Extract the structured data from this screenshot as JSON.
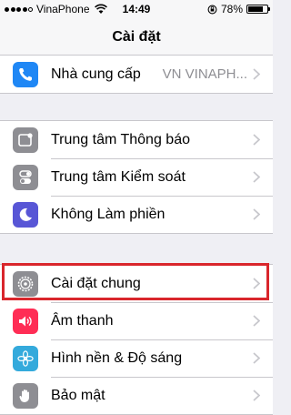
{
  "status_bar": {
    "signal_bars_filled": 4,
    "signal_bars_total": 5,
    "carrier": "VinaPhone",
    "time": "14:49",
    "battery_percent": "78%",
    "battery_level": 0.78,
    "icons": [
      "signal-dots",
      "wifi-icon",
      "rotation-lock-icon",
      "battery-icon"
    ]
  },
  "nav": {
    "title": "Cài đặt"
  },
  "groups": [
    {
      "items": [
        {
          "label": "Nhà cung cấp",
          "value": "VN VINAPH...",
          "icon": "phone-icon",
          "icon_color": "#1f87f5"
        }
      ]
    },
    {
      "items": [
        {
          "label": "Trung tâm Thông báo",
          "icon": "notification-center-icon",
          "icon_color": "#8e8e93"
        },
        {
          "label": "Trung tâm Kiểm soát",
          "icon": "control-center-icon",
          "icon_color": "#8e8e93"
        },
        {
          "label": "Không Làm phiền",
          "icon": "moon-icon",
          "icon_color": "#5856d6"
        }
      ]
    },
    {
      "items": [
        {
          "label": "Cài đặt chung",
          "icon": "gear-icon",
          "icon_color": "#8e8e93"
        },
        {
          "label": "Âm thanh",
          "icon": "speaker-icon",
          "icon_color": "#ff2d55"
        },
        {
          "label": "Hình nền & Độ sáng",
          "icon": "wallpaper-icon",
          "icon_color": "#34aadc"
        },
        {
          "label": "Bảo mật",
          "icon": "hand-icon",
          "icon_color": "#8e8e93"
        }
      ]
    }
  ],
  "colors": {
    "highlight": "#d9262c",
    "background": "#efeff4",
    "chevron": "#c7c7cc"
  }
}
